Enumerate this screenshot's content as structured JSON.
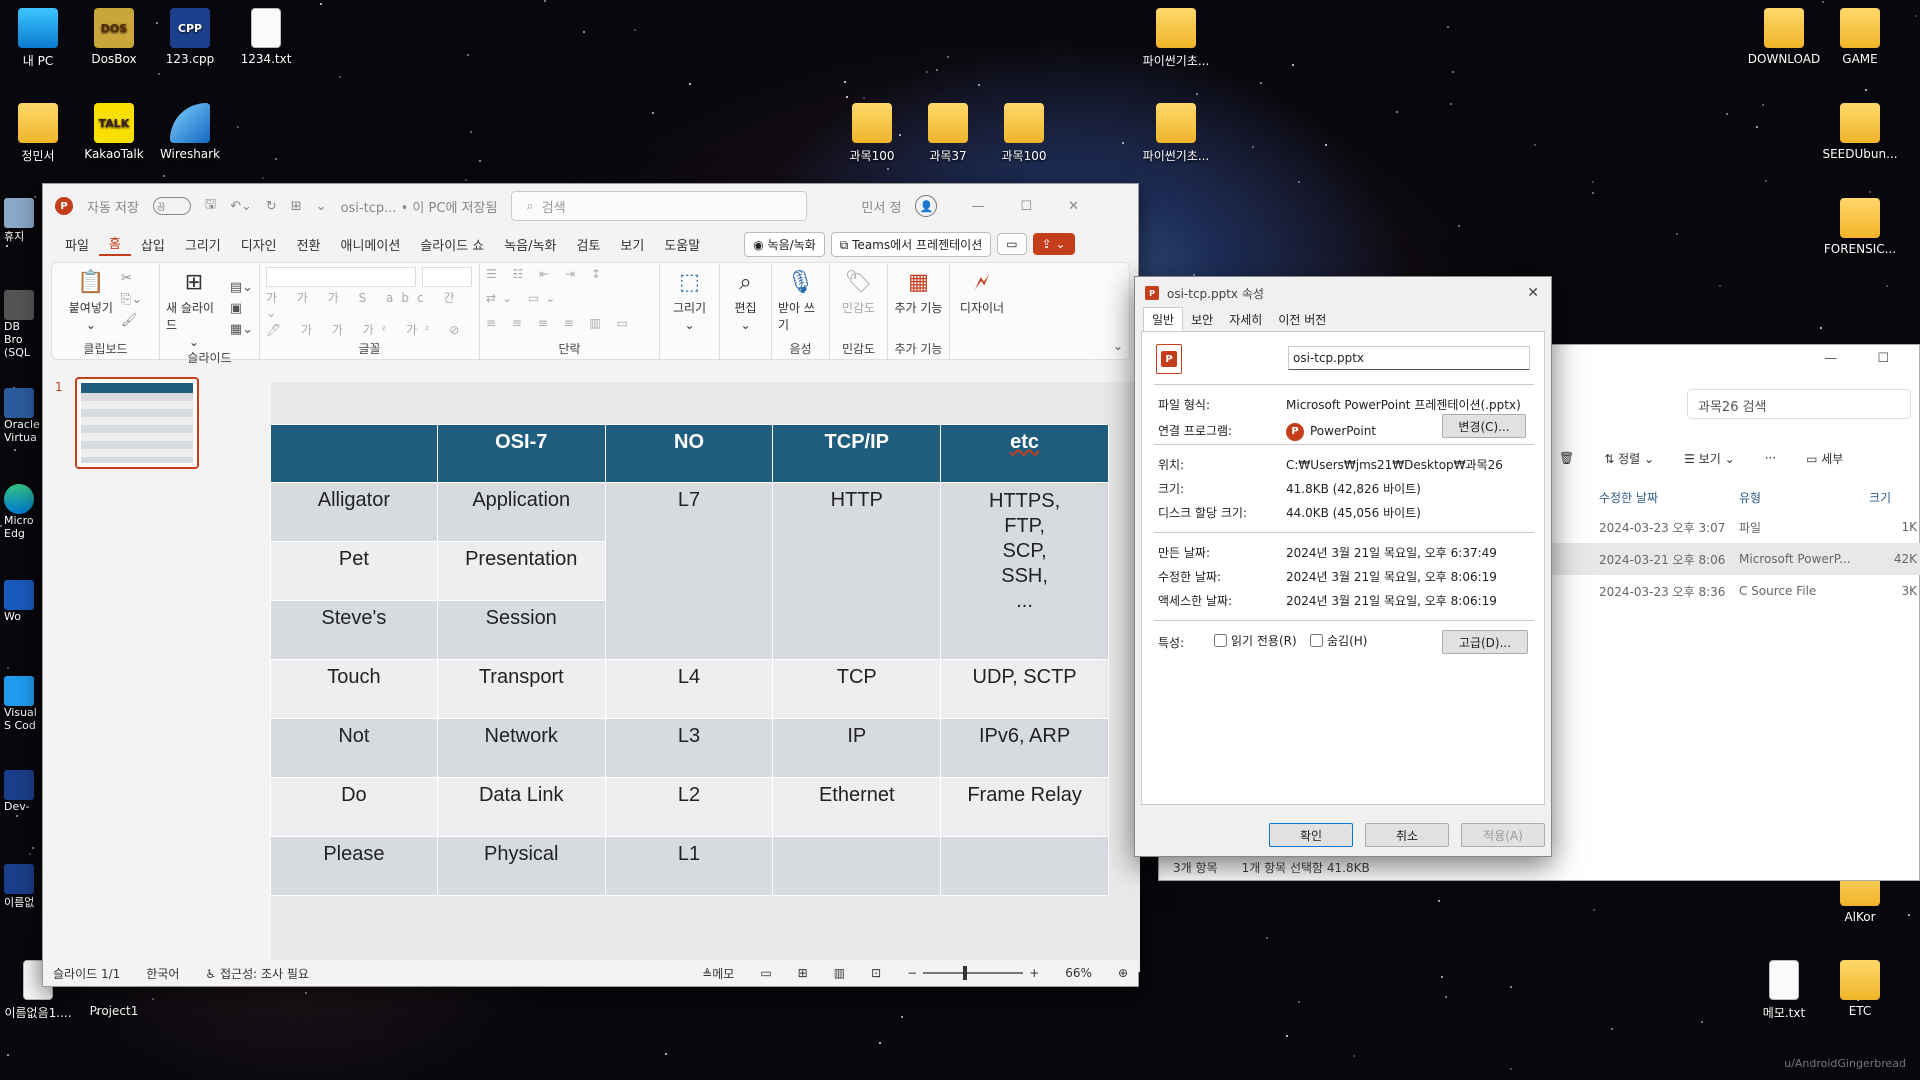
{
  "desktop": {
    "icons_left": [
      {
        "label": "내 PC",
        "type": "pc"
      },
      {
        "label": "DosBox",
        "type": "app",
        "glyph": "DOS"
      },
      {
        "label": "123.cpp",
        "type": "cpp"
      },
      {
        "label": "1234.txt",
        "type": "txt"
      },
      {
        "label": "정민서",
        "type": "folder"
      },
      {
        "label": "KakaoTalk",
        "type": "kakao"
      },
      {
        "label": "Wireshark",
        "type": "wireshark"
      }
    ],
    "icons_side": [
      "휴지",
      "DB Bro (SQL",
      "Oracle Virtua",
      "Micro Edg",
      "Wo",
      "Visual S Cod",
      "Dev-",
      "이름없",
      "이름없음1....",
      "Project1"
    ],
    "icons_center": [
      "과목100",
      "과목37",
      "과목100",
      "파이썬기초...",
      "파이썬기초..."
    ],
    "icons_right": [
      "DOWNLOAD",
      "GAME",
      "SEEDUbun...",
      "FORENSIC...",
      "AlKor",
      "메모.txt",
      "ETC"
    ],
    "watermark": "u/AndroidGingerbread"
  },
  "ppt": {
    "autosave_label": "자동 저장",
    "autosave_state": "끔",
    "title": "osi-tcp... • 이 PC에 저장됨",
    "search_placeholder": "검색",
    "user": "민서 정",
    "menu": [
      "파일",
      "홈",
      "삽입",
      "그리기",
      "디자인",
      "전환",
      "애니메이션",
      "슬라이드 쇼",
      "녹음/녹화",
      "검토",
      "보기",
      "도움말"
    ],
    "active_menu": "홈",
    "record_btn": "녹음/녹화",
    "teams_btn": "Teams에서 프레젠테이션",
    "ribbon": {
      "paste": "붙여넣기",
      "clipboard": "클립보드",
      "new_slide": "새 슬라이드",
      "slides": "슬라이드",
      "font": "글꼴",
      "paragraph": "단락",
      "draw": "그리기",
      "edit": "편집",
      "dictate": "받아 쓰기",
      "voice": "음성",
      "sensitivity": "민감도",
      "sensitivity_group": "민감도",
      "addins": "추가 기능",
      "addins_group": "추가 기능",
      "designer": "디자이너"
    },
    "slide_number": "1",
    "table": {
      "headers": [
        "",
        "OSI-7",
        "NO",
        "TCP/IP",
        "etc"
      ],
      "rows": [
        [
          "Alligator",
          "Application",
          "L7",
          "HTTP",
          "HTTPS,"
        ],
        [
          "Pet",
          "Presentation",
          "",
          "",
          "FTP,"
        ],
        [
          "Steve's",
          "Session",
          "",
          "",
          "SCP,"
        ],
        [
          "Touch",
          "Transport",
          "L4",
          "TCP",
          "UDP, SCTP"
        ],
        [
          "Not",
          "Network",
          "L3",
          "IP",
          "IPv6, ARP"
        ],
        [
          "Do",
          "Data Link",
          "L2",
          "Ethernet",
          "Frame Relay"
        ],
        [
          "Please",
          "Physical",
          "L1",
          "",
          ""
        ]
      ],
      "etc_extra": [
        "SSH,",
        "..."
      ]
    },
    "status": {
      "slide": "슬라이드 1/1",
      "lang": "한국어",
      "access": "접근성: 조사 필요",
      "notes": "메모",
      "zoom": "66%"
    }
  },
  "explorer": {
    "search": "과목26 검색",
    "sort": "정렬",
    "view": "보기",
    "detail": "세부",
    "cols": [
      "수정한 날짜",
      "유형",
      "크기"
    ],
    "rows": [
      [
        "2024-03-23 오후 3:07",
        "파일",
        "1K"
      ],
      [
        "2024-03-21 오후 8:06",
        "Microsoft PowerP...",
        "42K"
      ],
      [
        "2024-03-23 오후 8:36",
        "C Source File",
        "3K"
      ]
    ],
    "status_count": "3개 항목",
    "status_sel": "1개 항목 선택함 41.8KB"
  },
  "props": {
    "title": "osi-tcp.pptx 속성",
    "tabs": [
      "일반",
      "보안",
      "자세히",
      "이전 버전"
    ],
    "filename": "osi-tcp.pptx",
    "type_k": "파일 형식:",
    "type_v": "Microsoft PowerPoint 프레젠테이션(.pptx)",
    "open_k": "연결 프로그램:",
    "open_v": "PowerPoint",
    "change_btn": "변경(C)...",
    "loc_k": "위치:",
    "loc_v": "C:₩Users₩jms21₩Desktop₩과목26",
    "size_k": "크기:",
    "size_v": "41.8KB (42,826 바이트)",
    "disk_k": "디스크 할당 크기:",
    "disk_v": "44.0KB (45,056 바이트)",
    "created_k": "만든 날짜:",
    "created_v": "2024년 3월 21일 목요일, 오후 6:37:49",
    "modified_k": "수정한 날짜:",
    "modified_v": "2024년 3월 21일 목요일, 오후 8:06:19",
    "accessed_k": "액세스한 날짜:",
    "accessed_v": "2024년 3월 21일 목요일, 오후 8:06:19",
    "attr_k": "특성:",
    "readonly": "읽기 전용(R)",
    "hidden": "숨김(H)",
    "advanced_btn": "고급(D)...",
    "ok": "확인",
    "cancel": "취소",
    "apply": "적용(A)"
  }
}
